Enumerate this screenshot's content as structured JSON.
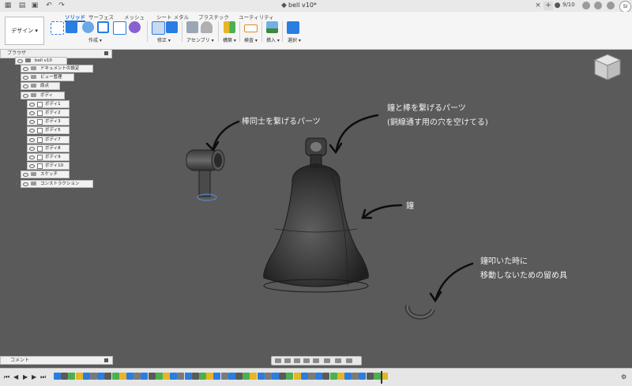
{
  "titlebar": {
    "document_title": "bell v10*",
    "tab_count": "9/10",
    "user_initials": "SI",
    "new_tab_glyph": "+",
    "close_glyph": "×"
  },
  "ribbon": {
    "workspace": "デザイン ▾",
    "tabs": [
      "ソリッド",
      "サーフェス",
      "メッシュ",
      "シート メタル",
      "プラスチック",
      "ユーティリティ"
    ],
    "active_tab": 0,
    "groups": [
      "作成 ▾",
      "修正 ▾",
      "アセンブリ ▾",
      "構築 ▾",
      "検査 ▾",
      "挿入 ▾",
      "選択 ▾"
    ]
  },
  "browser": {
    "title": "ブラウザ",
    "root": "bell v10",
    "items": [
      {
        "label": "ドキュメントの設定",
        "level": 1
      },
      {
        "label": "ビュー管理",
        "level": 1
      },
      {
        "label": "原点",
        "level": 1
      },
      {
        "label": "ボディ",
        "level": 1
      },
      {
        "label": "ボディ1",
        "level": 2
      },
      {
        "label": "ボディ2",
        "level": 2
      },
      {
        "label": "ボディ3",
        "level": 2
      },
      {
        "label": "ボディ5",
        "level": 2
      },
      {
        "label": "ボディ7",
        "level": 2
      },
      {
        "label": "ボディ8",
        "level": 2
      },
      {
        "label": "ボディ9",
        "level": 2
      },
      {
        "label": "ボディ10",
        "level": 2
      },
      {
        "label": "スケッチ",
        "level": 1
      },
      {
        "label": "コンストラクション",
        "level": 1
      }
    ]
  },
  "annotations": {
    "rod_connector": "棒同士を繋げるパーツ",
    "bell_connector_line1": "鐘と棒を繋げるパーツ",
    "bell_connector_line2": "(銅線通す用の穴を空けてる)",
    "bell": "鐘",
    "stopper_line1": "鐘叩いた時に",
    "stopper_line2": "移動しないための留め具"
  },
  "comments": {
    "label": "コメント"
  },
  "colors": {
    "viewport": "#5a5a5a",
    "accent": "#1e6fd0",
    "annotation_text": "#f2f2f2"
  },
  "icons": [
    "app-menu-icon",
    "save-icon",
    "undo-icon",
    "redo-icon",
    "viewcube-icon",
    "home-icon",
    "orbit-icon",
    "pan-icon",
    "zoom-icon",
    "display-settings-icon",
    "grid-icon",
    "play-icon",
    "step-back-icon",
    "step-forward-icon"
  ]
}
